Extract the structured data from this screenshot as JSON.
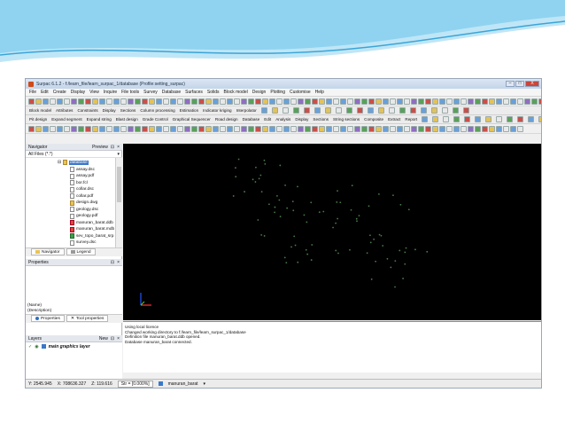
{
  "window": {
    "title": "Surpac 6.1.2 - f:/learn_file/learn_surpac_1/database (Profile:setting_surpac)",
    "controls": [
      "–",
      "□",
      "X"
    ]
  },
  "menu": [
    "File",
    "Edit",
    "Create",
    "Display",
    "View",
    "Inquire",
    "File tools",
    "Survey",
    "Database",
    "Surfaces",
    "Solids",
    "Block model",
    "Design",
    "Plotting",
    "Customise",
    "Help"
  ],
  "tabs_row1": [
    "Block model",
    "Attributes",
    "Constraints",
    "Display",
    "Sections",
    "Column processing",
    "Estimation",
    "Indicator kriging",
    "Interpolator"
  ],
  "tabs_row2": [
    "Pit design",
    "Expand segment",
    "Expand string",
    "Blast design",
    "Grade Control",
    "Graphical Sequencer",
    "Road design",
    "Database",
    "Edit",
    "Analysis",
    "Display",
    "Sections",
    "String sections",
    "Composite",
    "Extract",
    "Report"
  ],
  "navigator": {
    "title": "Navigator",
    "preview_label": "Preview",
    "filter": "All Files (*.*)",
    "root_folder": "database",
    "files": [
      "assay.dsc",
      "assay.pdf",
      "bor.fcl",
      "collar.dsc",
      "collar.pdf",
      "design.dwg",
      "geology.dsc",
      "geology.pdf",
      "manuran_barat.ddb",
      "manuran_barat.mdb",
      "sev_topo_barat_srp.dwg",
      "survey.dsc"
    ],
    "tabs": [
      "Navigator",
      "Legend"
    ]
  },
  "properties": {
    "title": "Properties",
    "name_label": "(Name)",
    "description_label": "(Description)",
    "tabs": [
      "Properties",
      "Tool properties"
    ]
  },
  "layers": {
    "title": "Layers",
    "new_label": "New",
    "items": [
      {
        "name": "main graphics layer"
      }
    ]
  },
  "console": {
    "lines": [
      "Using local licence",
      "Changed working directory to f:/learn_file/learn_surpac_1/database",
      "Definition file manuran_barat.ddb opened.",
      "Database manuran_barat connected."
    ]
  },
  "status": {
    "y": "Y: 2545.945",
    "x": "X: 708636.327",
    "z": "Z: 119.616",
    "str": "Str = [0.000%]",
    "db": "manuran_barat"
  },
  "colors": {
    "viewport_bg": "#000000",
    "points": "#4a7d4a",
    "wave_blue": "#6fc3e8"
  }
}
